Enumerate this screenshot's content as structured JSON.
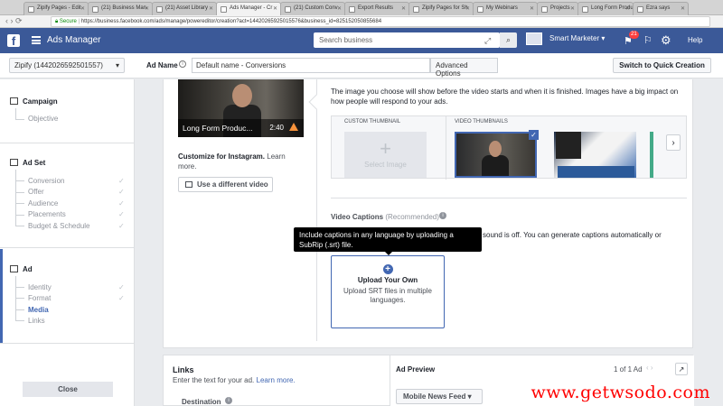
{
  "browser": {
    "tabs": [
      {
        "label": "Zipify Pages - Edit"
      },
      {
        "label": "(21) Business Man"
      },
      {
        "label": "(21) Asset Library"
      },
      {
        "label": "Ads Manager - Cr"
      },
      {
        "label": "(21) Custom Conv"
      },
      {
        "label": "Export Results"
      },
      {
        "label": "Zipify Pages for Sh"
      },
      {
        "label": "My Webinars"
      },
      {
        "label": "Projects"
      },
      {
        "label": "Long Form Produ"
      },
      {
        "label": "Ezra says"
      }
    ],
    "url_secure": "Secure",
    "url": "https://business.facebook.com/ads/manage/powereditor/creation?act=14420265925015576&business_id=825152050855684"
  },
  "fb": {
    "logo": "f",
    "title": "Ads Manager",
    "search_placeholder": "Search business",
    "account_name": "Smart Marketer",
    "notifications": "21",
    "help": "Help"
  },
  "toolbar": {
    "account": "Zipify (1442026592501557)",
    "ad_name_label": "Ad Name",
    "ad_name_value": "Default name - Conversions",
    "advanced_options": "Advanced Options",
    "quick_creation": "Switch to Quick Creation"
  },
  "sidebar": {
    "campaign": {
      "label": "Campaign",
      "steps": [
        {
          "label": "Objective"
        }
      ]
    },
    "adset": {
      "label": "Ad Set",
      "steps": [
        {
          "label": "Conversion"
        },
        {
          "label": "Offer"
        },
        {
          "label": "Audience"
        },
        {
          "label": "Placements"
        },
        {
          "label": "Budget & Schedule"
        }
      ]
    },
    "ad": {
      "label": "Ad",
      "steps": [
        {
          "label": "Identity"
        },
        {
          "label": "Format"
        },
        {
          "label": "Media"
        },
        {
          "label": "Links"
        }
      ]
    },
    "close": "Close"
  },
  "media": {
    "video_title": "Long Form Produc...",
    "video_duration": "2:40",
    "customize_bold": "Customize for Instagram.",
    "learn_more": "Learn more.",
    "different_video": "Use a different video",
    "thumb_desc": "The image you choose will show before the video starts and when it is finished. Images have a big impact on how people will respond to your ads.",
    "custom_thumb_label": "CUSTOM THUMBNAIL",
    "video_thumbs_label": "VIDEO THUMBNAILS",
    "select_image": "Select Image",
    "next_arrow": "›",
    "captions_title": "Video Captions",
    "captions_rec": "(Recommended)",
    "captions_desc": "sound is off. You can generate captions automatically or",
    "tooltip": "Include captions in any language by uploading a SubRip (.srt) file.",
    "upload_title": "Upload Your Own",
    "upload_desc": "Upload SRT files in multiple languages."
  },
  "links": {
    "title": "Links",
    "desc": "Enter the text for your ad.",
    "learn_more": "Learn more.",
    "destination": "Destination"
  },
  "preview": {
    "title": "Ad Preview",
    "count": "1 of 1 Ad",
    "nav": "‹ ›",
    "placement": "Mobile News Feed"
  },
  "watermark": "www.getwsodo.com"
}
